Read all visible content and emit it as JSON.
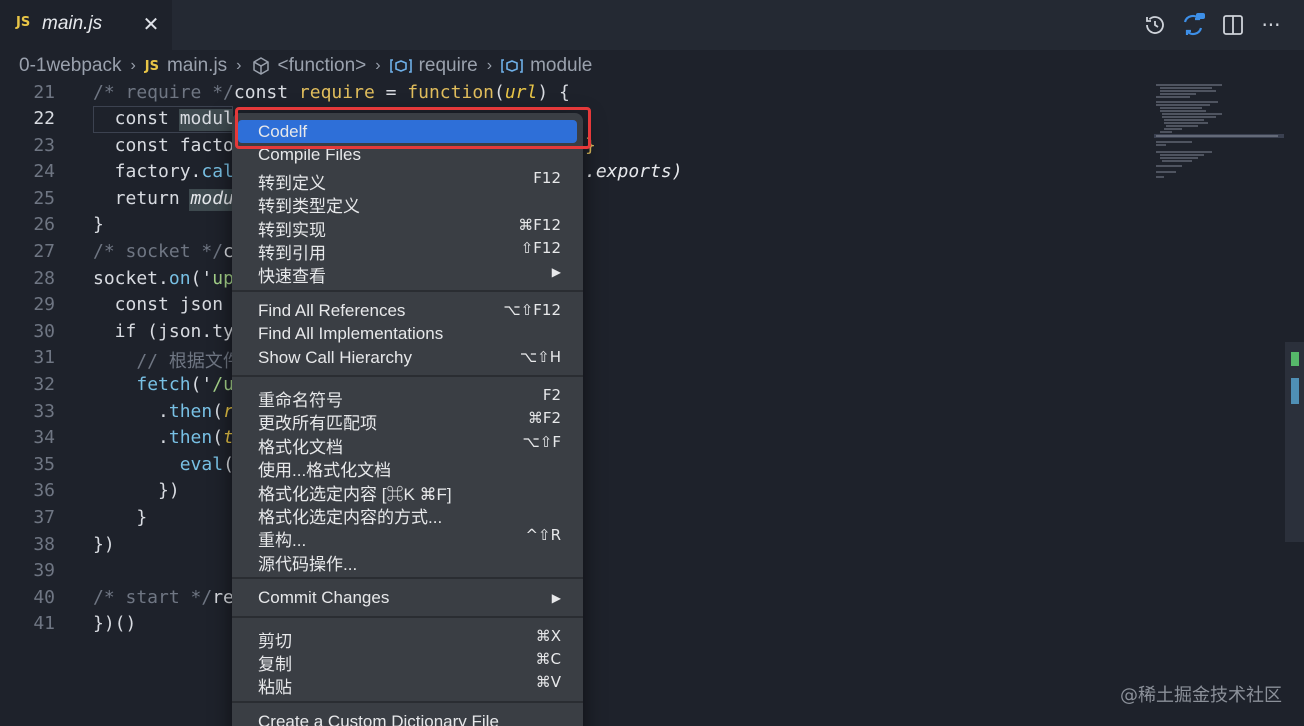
{
  "tab": {
    "badge": "JS",
    "label": "main.js",
    "close": "✕"
  },
  "toolbar": {
    "icons": [
      "history-icon",
      "sync-icon",
      "split-editor-icon",
      "more-icon"
    ],
    "more": "···"
  },
  "breadcrumb": [
    {
      "label": "0-1webpack",
      "icon": ""
    },
    {
      "label": "main.js",
      "icon": "JS"
    },
    {
      "label": "<function>",
      "icon": "cube-icon"
    },
    {
      "label": "require",
      "icon": "variable-icon"
    },
    {
      "label": "module",
      "icon": "variable-icon"
    }
  ],
  "editor": {
    "active_line": "22",
    "line_numbers": [
      "21",
      "22",
      "23",
      "24",
      "25",
      "26",
      "27",
      "28",
      "29",
      "30",
      "31",
      "32",
      "33",
      "34",
      "35",
      "36",
      "37",
      "38",
      "39",
      "40",
      "41"
    ],
    "lines": {
      "l21": {
        "a": "/* require */",
        "b": "const ",
        "c": "require",
        "d": " = ",
        "e": "function",
        "f": "(",
        "g": "url",
        "h": ") {"
      },
      "l22": {
        "a": "  const ",
        "b": "modul"
      },
      "l23": {
        "a": "  const facto"
      },
      "l24": {
        "a": "  factory.",
        "b": "cal"
      },
      "l25": {
        "a": "  return ",
        "b": "modu"
      },
      "l26": {
        "a": "}"
      },
      "l27": {
        "a": "/* socket */",
        "b": "c"
      },
      "l28": {
        "a": "socket.",
        "b": "on",
        "c": "('",
        "d": "up"
      },
      "l29": {
        "a": "  const json"
      },
      "l30": {
        "a": "  if (json.ty"
      },
      "l31": {
        "a": "    // 根据文件"
      },
      "l32": {
        "a": "    ",
        "b": "fetch",
        "c": "('",
        "d": "/u"
      },
      "l33": {
        "a": "      .",
        "b": "then",
        "c": "(",
        "d": "r"
      },
      "l34": {
        "a": "      .",
        "b": "then",
        "c": "(",
        "d": "t"
      },
      "l35": {
        "a": "        ",
        "b": "eval",
        "c": "("
      },
      "l36": {
        "a": "      })"
      },
      "l37": {
        "a": "    }"
      },
      "l38": {
        "a": "})"
      },
      "l39": {
        "a": ""
      },
      "l40": {
        "a": "/* start */",
        "b": "re"
      },
      "l41": {
        "a": "})()"
      },
      "peek22": "{",
      "peek23": "}",
      "peek24": ".exports)"
    }
  },
  "context_menu": {
    "groups": [
      [
        {
          "label": "Codelf",
          "shortcut": "",
          "selected": true
        },
        {
          "label": "Compile Files",
          "shortcut": ""
        },
        {
          "label": "转到定义",
          "shortcut": "F12"
        },
        {
          "label": "转到类型定义",
          "shortcut": ""
        },
        {
          "label": "转到实现",
          "shortcut": "⌘F12"
        },
        {
          "label": "转到引用",
          "shortcut": "⇧F12"
        },
        {
          "label": "快速查看",
          "shortcut": "▶"
        }
      ],
      [
        {
          "label": "Find All References",
          "shortcut": "⌥⇧F12"
        },
        {
          "label": "Find All Implementations",
          "shortcut": ""
        },
        {
          "label": "Show Call Hierarchy",
          "shortcut": "⌥⇧H"
        }
      ],
      [
        {
          "label": "重命名符号",
          "shortcut": "F2"
        },
        {
          "label": "更改所有匹配项",
          "shortcut": "⌘F2"
        },
        {
          "label": "格式化文档",
          "shortcut": "⌥⇧F"
        },
        {
          "label": "使用...格式化文档",
          "shortcut": ""
        },
        {
          "label": "格式化选定内容 [⌘K ⌘F]",
          "shortcut": ""
        },
        {
          "label": "格式化选定内容的方式...",
          "shortcut": ""
        },
        {
          "label": "重构...",
          "shortcut": "^⇧R"
        },
        {
          "label": "源代码操作...",
          "shortcut": ""
        }
      ],
      [
        {
          "label": "Commit Changes",
          "shortcut": "▶"
        }
      ],
      [
        {
          "label": "剪切",
          "shortcut": "⌘X"
        },
        {
          "label": "复制",
          "shortcut": "⌘C"
        },
        {
          "label": "粘贴",
          "shortcut": "⌘V"
        }
      ],
      [
        {
          "label": "Create a Custom Dictionary File",
          "shortcut": ""
        }
      ]
    ]
  },
  "watermark": "@稀土掘金技术社区",
  "colors": {
    "background": "#1e222b",
    "menu_background": "#3a3e44",
    "selection": "#2e6fd8",
    "annotation_red": "#e5393a"
  }
}
